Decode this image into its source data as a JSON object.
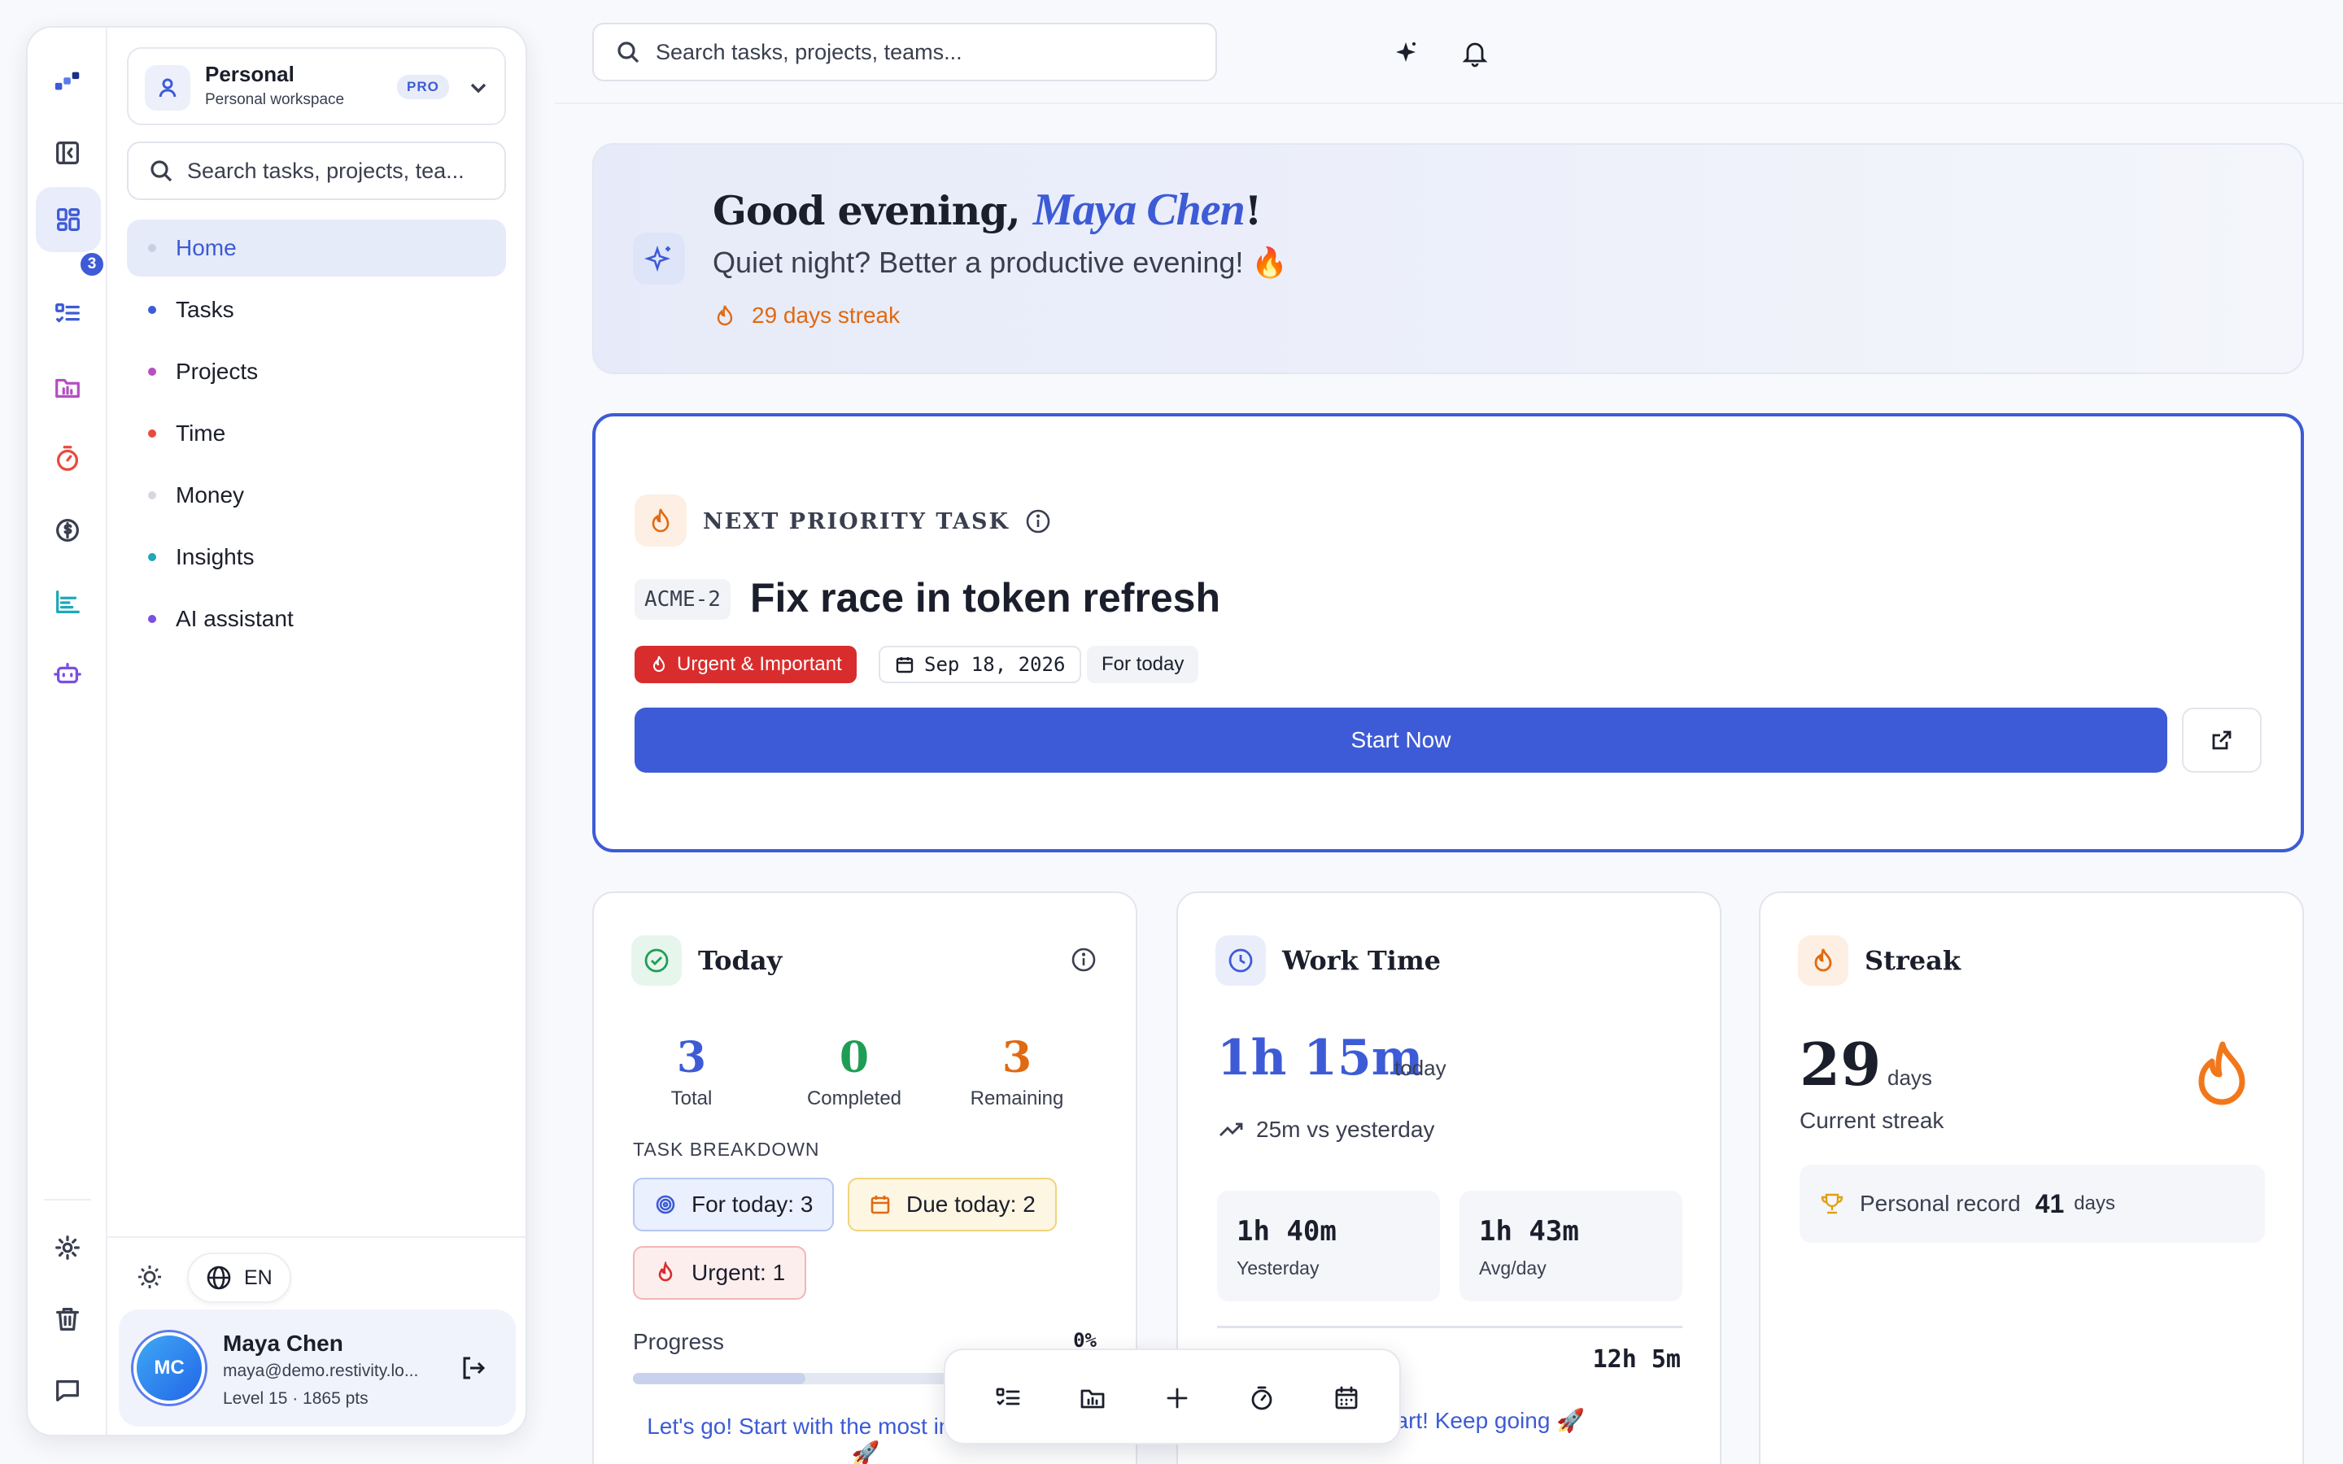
{
  "sidebar": {
    "rail_badge": "3",
    "workspace": {
      "name": "Personal",
      "subtitle": "Personal workspace",
      "badge": "PRO"
    },
    "search_placeholder": "Search tasks, projects, tea...",
    "nav": [
      {
        "label": "Home",
        "color": "#c9cfe0",
        "active": true
      },
      {
        "label": "Tasks",
        "color": "#3d5bd6"
      },
      {
        "label": "Projects",
        "color": "#b54fc2"
      },
      {
        "label": "Time",
        "color": "#e84a3c"
      },
      {
        "label": "Money",
        "color": "#d5d8e0"
      },
      {
        "label": "Insights",
        "color": "#1fa8b8"
      },
      {
        "label": "AI assistant",
        "color": "#7b4fe0"
      }
    ],
    "language": "EN",
    "user": {
      "initials": "MC",
      "name": "Maya Chen",
      "email": "maya@demo.restivity.lo...",
      "level": "Level 15 · 1865 pts"
    }
  },
  "topbar": {
    "search_placeholder": "Search tasks, projects, teams..."
  },
  "hero": {
    "greeting": "Good evening, ",
    "name": "Maya Chen",
    "punct": "!",
    "subtitle": "Quiet night? Better a productive evening! 🔥",
    "streak": "29 days streak"
  },
  "priority": {
    "label": "NEXT PRIORITY TASK",
    "key": "ACME-2",
    "title": "Fix race in token refresh",
    "tag": "Urgent & Important",
    "date": "Sep 18, 2026",
    "when": "For today",
    "start_label": "Start Now"
  },
  "today": {
    "title": "Today",
    "stats": [
      {
        "value": "3",
        "label": "Total",
        "color": "#3d5bd6"
      },
      {
        "value": "0",
        "label": "Completed",
        "color": "#1f9d55"
      },
      {
        "value": "3",
        "label": "Remaining",
        "color": "#e06a12"
      }
    ],
    "breakdown_label": "TASK BREAKDOWN",
    "pills": {
      "for_today": "For today: 3",
      "due_today": "Due today: 2",
      "urgent": "Urgent: 1"
    },
    "progress_label": "Progress",
    "progress_value": "0%",
    "progress": 0,
    "encourage": "Let's go! Start with the most important thing 🚀"
  },
  "worktime": {
    "title": "Work Time",
    "today_value": "1h 15m",
    "today_label": "today",
    "vs": "25m vs yesterday",
    "boxes": [
      {
        "value": "1h 40m",
        "label": "Yesterday"
      },
      {
        "value": "1h 43m",
        "label": "Avg/day"
      }
    ],
    "total": "12h 5m",
    "encourage": "Great start! Keep going 🚀"
  },
  "streak": {
    "title": "Streak",
    "value": "29",
    "unit": "days",
    "label": "Current streak",
    "record_label": "Personal record",
    "record_value": "41",
    "record_unit": "days"
  },
  "colors": {
    "accent": "#3d5bd6",
    "orange": "#e06a12",
    "red": "#d92d2d",
    "green": "#1f9d55"
  }
}
